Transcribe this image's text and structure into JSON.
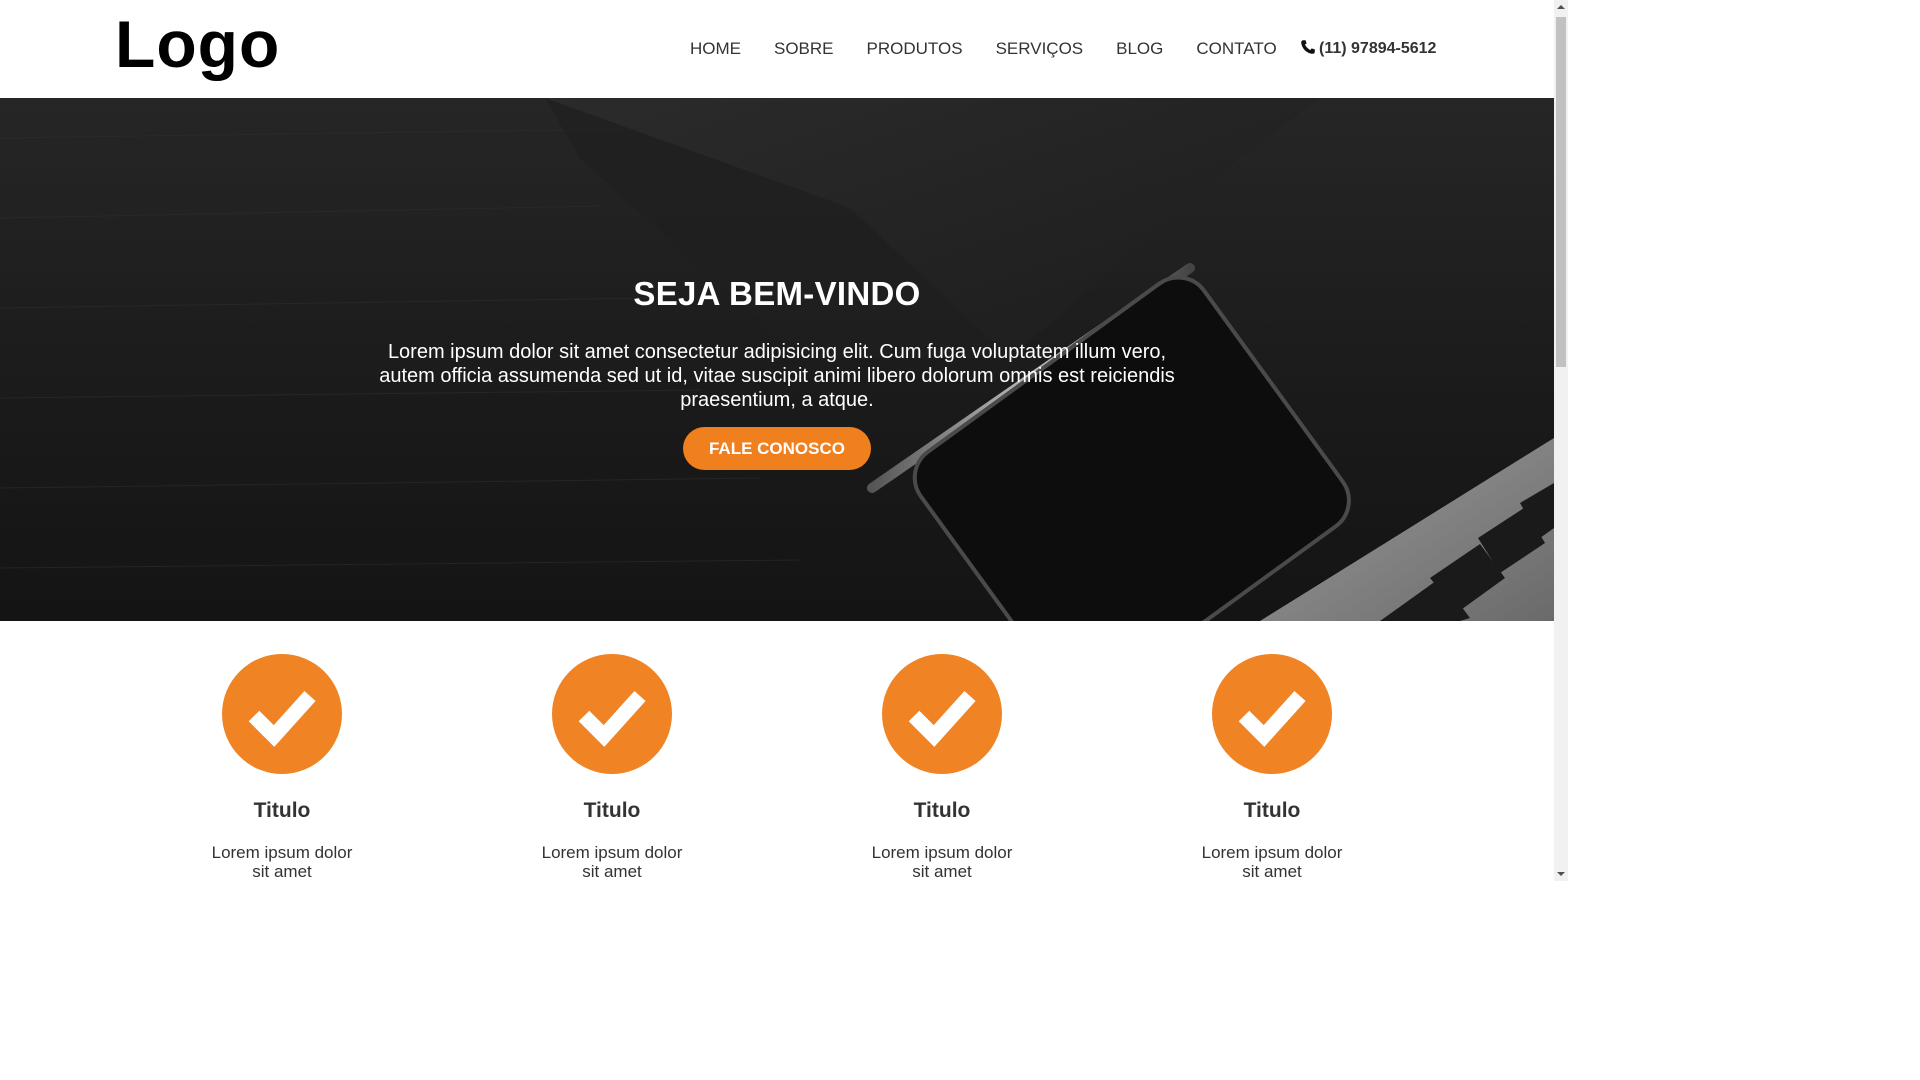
{
  "header": {
    "logo": "Logo",
    "nav": [
      "HOME",
      "SOBRE",
      "PRODUTOS",
      "SERVIÇOS",
      "BLOG",
      "CONTATO"
    ],
    "phone": "(11) 97894-5612",
    "phone_icon": "phone-icon"
  },
  "hero": {
    "title": "SEJA BEM-VINDO",
    "text": "Lorem ipsum dolor sit amet consectetur adipisicing elit. Cum fuga voluptatem illum vero, autem officia assumenda sed ut id, vitae suscipit animi libero dolorum omnis est reiciendis praesentium, a atque.",
    "button": "FALE CONOSCO"
  },
  "features": [
    {
      "title": "Titulo",
      "text": "Lorem ipsum dolor sit amet consectetur",
      "icon": "check-icon"
    },
    {
      "title": "Titulo",
      "text": "Lorem ipsum dolor sit amet consectetur",
      "icon": "check-icon"
    },
    {
      "title": "Titulo",
      "text": "Lorem ipsum dolor sit amet consectetur",
      "icon": "check-icon"
    },
    {
      "title": "Titulo",
      "text": "Lorem ipsum dolor sit amet consectetur",
      "icon": "check-icon"
    }
  ],
  "colors": {
    "accent": "#f08323",
    "hero_dark": "#1a1a1a",
    "text": "#333333"
  }
}
